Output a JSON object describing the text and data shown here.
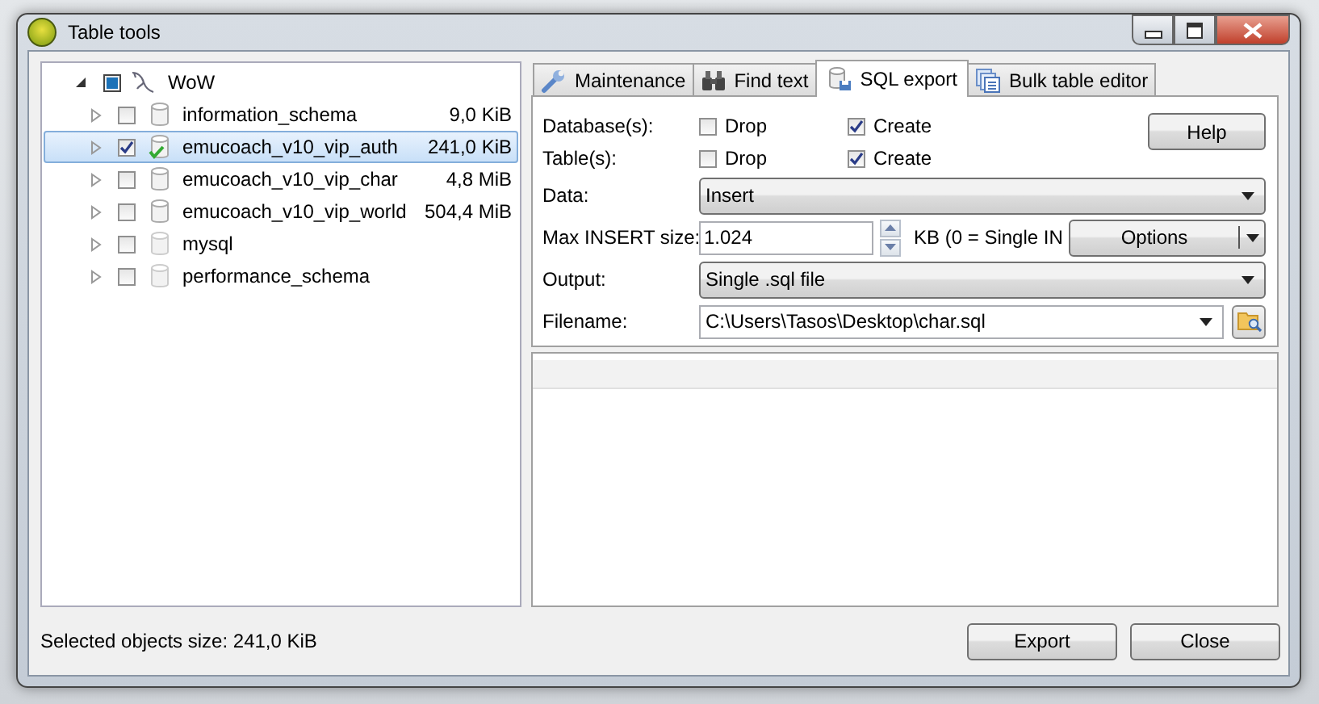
{
  "window": {
    "title": "Table tools"
  },
  "tree": {
    "label": "WoW",
    "expanded": true,
    "checked": false,
    "indeterminate": true,
    "children": [
      {
        "label": "information_schema",
        "size": "9,0 KiB",
        "checked": false,
        "selected": false,
        "expanded": false
      },
      {
        "label": "emucoach_v10_vip_auth",
        "size": "241,0 KiB",
        "checked": true,
        "selected": true,
        "expanded": false
      },
      {
        "label": "emucoach_v10_vip_char",
        "size": "4,8 MiB",
        "checked": false,
        "selected": false,
        "expanded": false
      },
      {
        "label": "emucoach_v10_vip_world",
        "size": "504,4 MiB",
        "checked": false,
        "selected": false,
        "expanded": false
      },
      {
        "label": "mysql",
        "checked": false,
        "selected": false,
        "expanded": false
      },
      {
        "label": "performance_schema",
        "checked": false,
        "selected": false,
        "expanded": false
      }
    ]
  },
  "tabs": [
    {
      "label": "Maintenance",
      "selected": false
    },
    {
      "label": "Find text",
      "selected": false
    },
    {
      "label": "SQL export",
      "selected": true
    },
    {
      "label": "Bulk table editor",
      "selected": false
    }
  ],
  "export": {
    "checkbox_rows": [
      {
        "label": "Database(s):",
        "drop": {
          "label": "Drop",
          "checked": false
        },
        "create": {
          "label": "Create",
          "checked": true
        }
      },
      {
        "label": "Table(s):",
        "drop": {
          "label": "Drop",
          "checked": false
        },
        "create": {
          "label": "Create",
          "checked": true
        }
      }
    ],
    "help_button": "Help",
    "data": {
      "label": "Data:",
      "value": "Insert"
    },
    "max_insert": {
      "label": "Max INSERT size:",
      "value": "1.024",
      "unit": "KB (0 = Single IN"
    },
    "options_button": "Options",
    "output": {
      "label": "Output:",
      "value": "Single .sql file"
    },
    "filename": {
      "label": "Filename:",
      "value": "C:\\Users\\Tasos\\Desktop\\char.sql"
    }
  },
  "status": "Selected objects size: 241,0 KiB",
  "buttons": [
    "Export",
    "Close"
  ]
}
